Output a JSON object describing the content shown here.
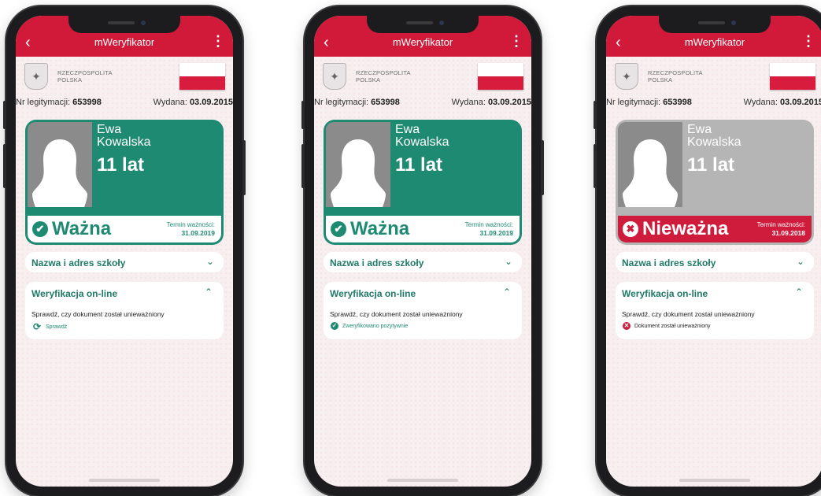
{
  "phones": [
    {
      "app_title": "mWeryfikator",
      "emblem_text_1": "RZECZPOSPOLITA",
      "emblem_text_2": "POLSKA",
      "id_label": "Nr legitymacji:",
      "id_number": "653998",
      "issued_label": "Wydana:",
      "issued_date": "03.09.2015",
      "first_name": "Ewa",
      "last_name": "Kowalska",
      "age": "11 lat",
      "status_label": "Ważna",
      "status_icon": "✔",
      "term_label": "Termin ważności:",
      "term_date": "31.09.2019",
      "section_school": "Nazwa i adres szkoły",
      "section_verify": "Weryfikacja on-line",
      "verify_question": "Sprawdź, czy dokument został unieważniony",
      "verify_result": "Sprawdź",
      "verify_icon": "refresh-icon"
    },
    {
      "app_title": "mWeryfikator",
      "emblem_text_1": "RZECZPOSPOLITA",
      "emblem_text_2": "POLSKA",
      "id_label": "Nr legitymacji:",
      "id_number": "653998",
      "issued_label": "Wydana:",
      "issued_date": "03.09.2015",
      "first_name": "Ewa",
      "last_name": "Kowalska",
      "age": "11 lat",
      "status_label": "Ważna",
      "status_icon": "✔",
      "term_label": "Termin ważności:",
      "term_date": "31.09.2019",
      "section_school": "Nazwa i adres szkoły",
      "section_verify": "Weryfikacja on-line",
      "verify_question": "Sprawdź, czy dokument został unieważniony",
      "verify_result": "Zweryfikowano pozytywnie",
      "verify_icon": "check-circle-icon"
    },
    {
      "app_title": "mWeryfikator",
      "emblem_text_1": "RZECZPOSPOLITA",
      "emblem_text_2": "POLSKA",
      "id_label": "Nr legitymacji:",
      "id_number": "653998",
      "issued_label": "Wydana:",
      "issued_date": "03.09.2015",
      "first_name": "Ewa",
      "last_name": "Kowalska",
      "age": "11 lat",
      "status_label": "Nieważna",
      "status_icon": "✖",
      "term_label": "Termin ważności:",
      "term_date": "31.09.2018",
      "section_school": "Nazwa i adres szkoły",
      "section_verify": "Weryfikacja on-line",
      "verify_question": "Sprawdź, czy dokument został unieważniony",
      "verify_result": "Dokument został unieważniony",
      "verify_icon": "x-circle-icon"
    }
  ],
  "colors": {
    "brand_red": "#d11a3a",
    "valid_green": "#1f8a72",
    "invalid_gray": "#b5b5b5",
    "invalid_red": "#cf1c3c"
  }
}
